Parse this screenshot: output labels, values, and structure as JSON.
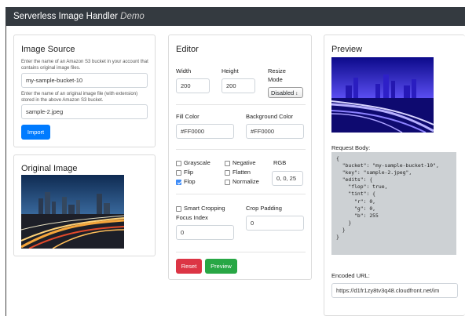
{
  "navbar": {
    "title": "Serverless Image Handler",
    "subtitle": "Demo"
  },
  "image_source": {
    "title": "Image Source",
    "bucket_help": "Enter the name of an Amazon S3 bucket in your account that contains original image files.",
    "bucket_value": "my-sample-bucket-10",
    "key_help": "Enter the name of an original image file (with extension) stored in the above Amazon S3 bucket.",
    "key_value": "sample-2.jpeg",
    "import_label": "Import"
  },
  "original_image": {
    "title": "Original Image"
  },
  "editor": {
    "title": "Editor",
    "width_label": "Width",
    "width_value": "200",
    "height_label": "Height",
    "height_value": "200",
    "resize_label_1": "Resize",
    "resize_label_2": "Mode",
    "resize_value": "Disabled",
    "fill_label": "Fill Color",
    "fill_value": "#FF0000",
    "bg_label": "Background Color",
    "bg_value": "#FF0000",
    "checks": {
      "grayscale": "Grayscale",
      "negative": "Negative",
      "flip": "Flip",
      "flatten": "Flatten",
      "flop": "Flop",
      "normalize": "Normalize"
    },
    "flop_checked": true,
    "rgb_label": "RGB",
    "rgb_value": "0, 0, 25",
    "smart_crop_label": "Smart Cropping",
    "focus_label": "Focus Index",
    "focus_value": "0",
    "crop_padding_label": "Crop Padding",
    "crop_padding_value": "0",
    "reset_label": "Reset",
    "preview_label": "Preview"
  },
  "preview": {
    "title": "Preview",
    "request_label": "Request Body:",
    "request_body": "{\n  \"bucket\": \"my-sample-bucket-10\",\n  \"key\": \"sample-2.jpeg\",\n  \"edits\": {\n    \"flop\": true,\n    \"tint\": {\n      \"r\": 0,\n      \"g\": 0,\n      \"b\": 255\n    }\n  }\n}",
    "encoded_label": "Encoded URL:",
    "encoded_value": "https://d1fr1zy8tv3q48.cloudfront.net/im"
  },
  "colors": {
    "navbar": "#343a40",
    "primary": "#007bff",
    "danger": "#dc3545",
    "success": "#28a745",
    "tint": "#1a10d8"
  }
}
